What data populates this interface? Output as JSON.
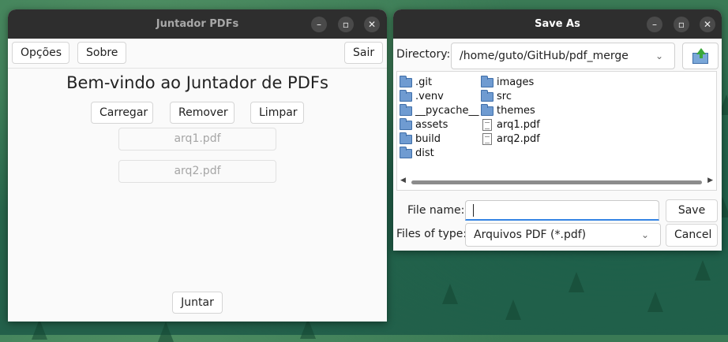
{
  "main_window": {
    "title": "Juntador PDFs",
    "toolbar": {
      "options": "Opções",
      "about": "Sobre",
      "quit": "Sair"
    },
    "heading": "Bem-vindo ao Juntador de PDFs",
    "actions": {
      "load": "Carregar",
      "remove": "Remover",
      "clear": "Limpar"
    },
    "files": [
      "arq1.pdf",
      "arq2.pdf"
    ],
    "join": "Juntar"
  },
  "save_dialog": {
    "title": "Save As",
    "directory_label": "Directory:",
    "directory_value": "/home/guto/GitHub/pdf_merge",
    "entries_col1": [
      {
        "name": ".git",
        "kind": "folder"
      },
      {
        "name": ".venv",
        "kind": "folder"
      },
      {
        "name": "__pycache__",
        "kind": "folder"
      },
      {
        "name": "assets",
        "kind": "folder"
      },
      {
        "name": "build",
        "kind": "folder"
      },
      {
        "name": "dist",
        "kind": "folder"
      }
    ],
    "entries_col2": [
      {
        "name": "images",
        "kind": "folder"
      },
      {
        "name": "src",
        "kind": "folder"
      },
      {
        "name": "themes",
        "kind": "folder"
      },
      {
        "name": "arq1.pdf",
        "kind": "file"
      },
      {
        "name": "arq2.pdf",
        "kind": "file"
      }
    ],
    "filename_label": "File name:",
    "filename_value": "",
    "save": "Save",
    "filetype_label": "Files of type:",
    "filetype_value": "Arquivos PDF (*.pdf)",
    "cancel": "Cancel"
  },
  "icons": {
    "minimize": "minimize-icon",
    "maximize": "maximize-icon",
    "close": "close-icon",
    "folder_up": "folder-up-icon"
  }
}
